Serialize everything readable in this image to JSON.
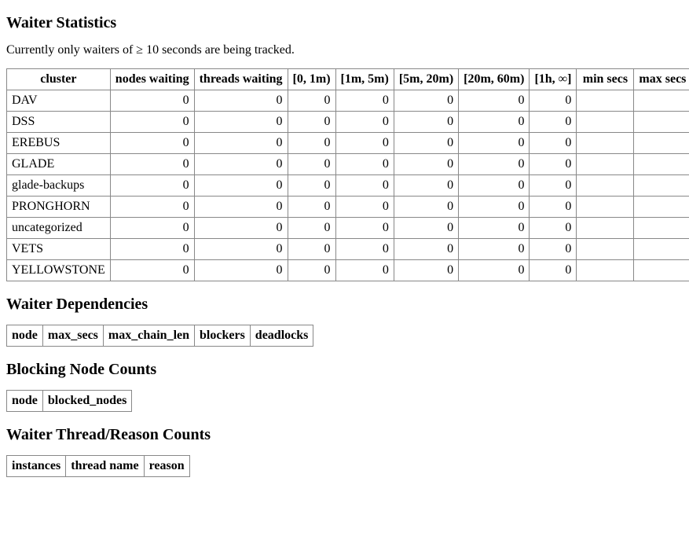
{
  "section1": {
    "heading": "Waiter Statistics",
    "intro": "Currently only waiters of ≥ 10 seconds are being tracked.",
    "headers": [
      "cluster",
      "nodes waiting",
      "threads waiting",
      "[0, 1m)",
      "[1m, 5m)",
      "[5m, 20m)",
      "[20m, 60m)",
      "[1h, ∞]",
      "min secs",
      "max secs"
    ],
    "rows": [
      {
        "cluster": "DAV",
        "nodes_waiting": "0",
        "threads_waiting": "0",
        "b0": "0",
        "b1": "0",
        "b2": "0",
        "b3": "0",
        "b4": "0",
        "min_secs": "",
        "max_secs": ""
      },
      {
        "cluster": "DSS",
        "nodes_waiting": "0",
        "threads_waiting": "0",
        "b0": "0",
        "b1": "0",
        "b2": "0",
        "b3": "0",
        "b4": "0",
        "min_secs": "",
        "max_secs": ""
      },
      {
        "cluster": "EREBUS",
        "nodes_waiting": "0",
        "threads_waiting": "0",
        "b0": "0",
        "b1": "0",
        "b2": "0",
        "b3": "0",
        "b4": "0",
        "min_secs": "",
        "max_secs": ""
      },
      {
        "cluster": "GLADE",
        "nodes_waiting": "0",
        "threads_waiting": "0",
        "b0": "0",
        "b1": "0",
        "b2": "0",
        "b3": "0",
        "b4": "0",
        "min_secs": "",
        "max_secs": ""
      },
      {
        "cluster": "glade-backups",
        "nodes_waiting": "0",
        "threads_waiting": "0",
        "b0": "0",
        "b1": "0",
        "b2": "0",
        "b3": "0",
        "b4": "0",
        "min_secs": "",
        "max_secs": ""
      },
      {
        "cluster": "PRONGHORN",
        "nodes_waiting": "0",
        "threads_waiting": "0",
        "b0": "0",
        "b1": "0",
        "b2": "0",
        "b3": "0",
        "b4": "0",
        "min_secs": "",
        "max_secs": ""
      },
      {
        "cluster": "uncategorized",
        "nodes_waiting": "0",
        "threads_waiting": "0",
        "b0": "0",
        "b1": "0",
        "b2": "0",
        "b3": "0",
        "b4": "0",
        "min_secs": "",
        "max_secs": ""
      },
      {
        "cluster": "VETS",
        "nodes_waiting": "0",
        "threads_waiting": "0",
        "b0": "0",
        "b1": "0",
        "b2": "0",
        "b3": "0",
        "b4": "0",
        "min_secs": "",
        "max_secs": ""
      },
      {
        "cluster": "YELLOWSTONE",
        "nodes_waiting": "0",
        "threads_waiting": "0",
        "b0": "0",
        "b1": "0",
        "b2": "0",
        "b3": "0",
        "b4": "0",
        "min_secs": "",
        "max_secs": ""
      }
    ]
  },
  "section2": {
    "heading": "Waiter Dependencies",
    "headers": [
      "node",
      "max_secs",
      "max_chain_len",
      "blockers",
      "deadlocks"
    ]
  },
  "section3": {
    "heading": "Blocking Node Counts",
    "headers": [
      "node",
      "blocked_nodes"
    ]
  },
  "section4": {
    "heading": "Waiter Thread/Reason Counts",
    "headers": [
      "instances",
      "thread name",
      "reason"
    ]
  }
}
